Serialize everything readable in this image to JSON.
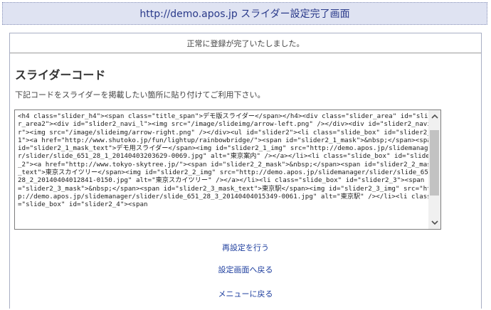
{
  "header": {
    "title": "http://demo.apos.jp スライダー設定完了画面"
  },
  "notice": "正常に登録が完了いたしました。",
  "section": {
    "title": "スライダーコード",
    "instruction": "下記コードをスライダーを掲載したい箇所に貼り付けてご利用下さい。"
  },
  "code": "<h4 class=\"slider_h4\"><span class=\"title_span\">デモ版スライダー</span></h4><div class=\"slider_area\" id=\"slider_area2\"><div id=\"slider2_navi_l\"><img src=\"/image/slideimg/arrow-left.png\" /></div><div id=\"slider2_navi_r\"><img src=\"/image/slideimg/arrow-right.png\" /></div><ul id=\"slider2\"><li class=\"slide_box\" id=\"slider2_1\"><a href=\"http://www.shutoko.jp/fun/lightup/rainbowbridge/\"><span id=\"slider2_1_mask\">&nbsp;</span><span id=\"slider2_1_mask_text\">デモ用スライダー</span><img id=\"slider2_1_img\" src=\"http://demo.apos.jp/slidemanager/slider/slide_651_28_1_20140403203629-0069.jpg\" alt=\"東京案内\" /></a></li><li class=\"slide_box\" id=\"slider2_2\"><a href=\"http://www.tokyo-skytree.jp/\"><span id=\"slider2_2_mask\">&nbsp;</span><span id=\"slider2_2_mask_text\">東京スカイツリー</span><img id=\"slider2_2_img\" src=\"http://demo.apos.jp/slidemanager/slider/slide_651_28_2_20140404012841-0150.jpg\" alt=\"東京スカイツリー\" /></a></li><li class=\"slide_box\" id=\"slider2_3\"><span id=\"slider2_3_mask\">&nbsp;</span><span id=\"slider2_3_mask_text\">東京駅</span><img id=\"slider2_3_img\" src=\"http://demo.apos.jp/slidemanager/slider/slide_651_28_3_20140404015349-0061.jpg\" alt=\"東京駅\" /></li><li class=\"slide_box\" id=\"slider2_4\"><span",
  "links": {
    "reset": "再設定を行う",
    "back_to_settings": "設定画面へ戻る",
    "back_to_menu": "メニューに戻る"
  },
  "icons": {
    "scroll_up": "chevron-up-icon",
    "scroll_down": "chevron-down-icon"
  },
  "colors": {
    "header_bg": "#dfe3f2",
    "header_text": "#2a3a8a",
    "link": "#1f3f9f"
  }
}
